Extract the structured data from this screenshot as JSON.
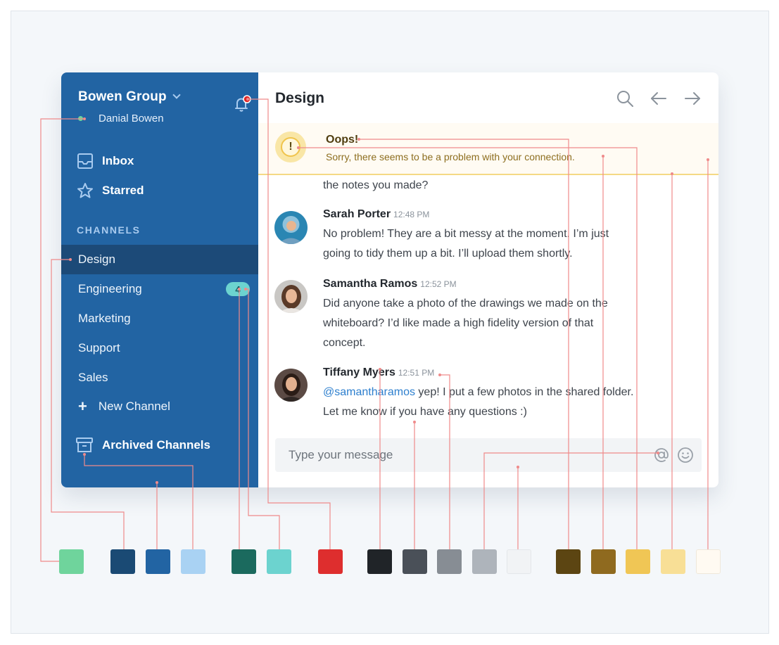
{
  "sidebar": {
    "team_name": "Bowen Group",
    "user_name": "Danial Bowen",
    "inbox_label": "Inbox",
    "starred_label": "Starred",
    "channels_header": "CHANNELS",
    "channels": [
      {
        "label": "Design",
        "active": true
      },
      {
        "label": "Engineering",
        "badge": "4"
      },
      {
        "label": "Marketing"
      },
      {
        "label": "Support"
      },
      {
        "label": "Sales"
      }
    ],
    "new_channel_label": "New Channel",
    "archived_label": "Archived Channels",
    "icons": [
      "chevron-down-icon",
      "bell-icon",
      "inbox-icon",
      "star-icon",
      "plus-icon",
      "archive-icon"
    ]
  },
  "main": {
    "channel_title": "Design",
    "header_icons": [
      "search-icon",
      "arrow-left-icon",
      "arrow-right-icon"
    ],
    "alert": {
      "title": "Oops!",
      "text": "Sorry, there seems to be a problem with your connection."
    },
    "partial_message": "the notes you made?",
    "messages": [
      {
        "sender": "Sarah Porter",
        "time": "12:48 PM",
        "lines": [
          "No problem! They are a bit messy at the moment. I’m just",
          "going to tidy them up a bit. I’ll upload them shortly."
        ]
      },
      {
        "sender": "Samantha Ramos",
        "time": "12:52 PM",
        "lines": [
          "Did anyone take a photo of the drawings we made on the",
          "whiteboard? I’d like made a high fidelity version of that",
          "concept."
        ]
      },
      {
        "sender": "Tiffany Myers",
        "time": "12:51 PM",
        "mention": "@samantharamos",
        "line1_rest": " yep! I put a few photos in the shared folder.",
        "line2": "Let me know if you have any questions :)"
      }
    ],
    "composer": {
      "placeholder": "Type your message",
      "icons": [
        "at-icon",
        "emoji-icon"
      ]
    }
  },
  "palette": {
    "greens": [
      "#6fd49c"
    ],
    "blues": [
      "#1a4a74",
      "#2264a3",
      "#a9d2f3"
    ],
    "teals": [
      "#1b6a5e",
      "#6cd3cf"
    ],
    "reds": [
      "#de2e2e"
    ],
    "grays": [
      "#202428",
      "#4a5058",
      "#878d94",
      "#aeb4bb",
      "#f1f3f5"
    ],
    "yellows": [
      "#5c4512",
      "#8f6a1f",
      "#f0c655",
      "#f8df96",
      "#fffaf2"
    ]
  }
}
